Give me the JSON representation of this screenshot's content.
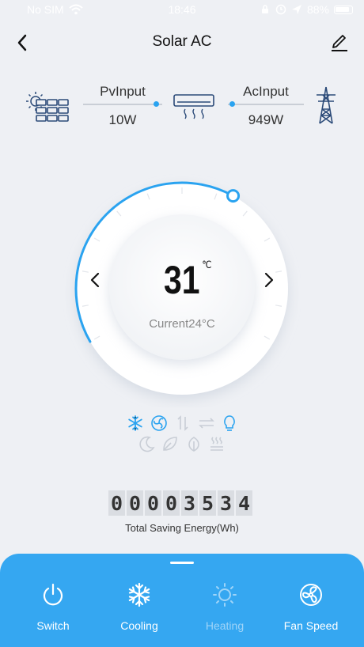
{
  "status_bar": {
    "carrier": "No SIM",
    "time": "18:46",
    "battery": "88%"
  },
  "nav": {
    "title": "Solar AC",
    "back_icon": "chevron-left-icon",
    "edit_icon": "pencil-icon"
  },
  "flow": {
    "pv_label": "PvInput",
    "pv_value": "10W",
    "ac_label": "AcInput",
    "ac_value": "949W"
  },
  "thermostat": {
    "setpoint": "31",
    "unit": "℃",
    "current": "Current24°C",
    "dial_fraction": 0.62,
    "accent": "#2aa3f0"
  },
  "modes": {
    "row1": [
      "snowflake-icon",
      "fan-icon",
      "up-down-arrows-icon",
      "left-right-arrows-icon",
      "bulb-icon"
    ],
    "row2": [
      "moon-icon",
      "leaf-icon",
      "eco-leaf-icon",
      "heat-waves-icon"
    ]
  },
  "energy": {
    "digits": [
      "0",
      "0",
      "0",
      "0",
      "3",
      "5",
      "3",
      "4"
    ],
    "label": "Total Saving Energy(Wh)"
  },
  "tabs": [
    {
      "label": "Switch",
      "icon": "power-icon",
      "enabled": true
    },
    {
      "label": "Cooling",
      "icon": "snowflake-icon",
      "enabled": true
    },
    {
      "label": "Heating",
      "icon": "sun-icon",
      "enabled": false
    },
    {
      "label": "Fan Speed",
      "icon": "fan-icon",
      "enabled": true
    }
  ]
}
